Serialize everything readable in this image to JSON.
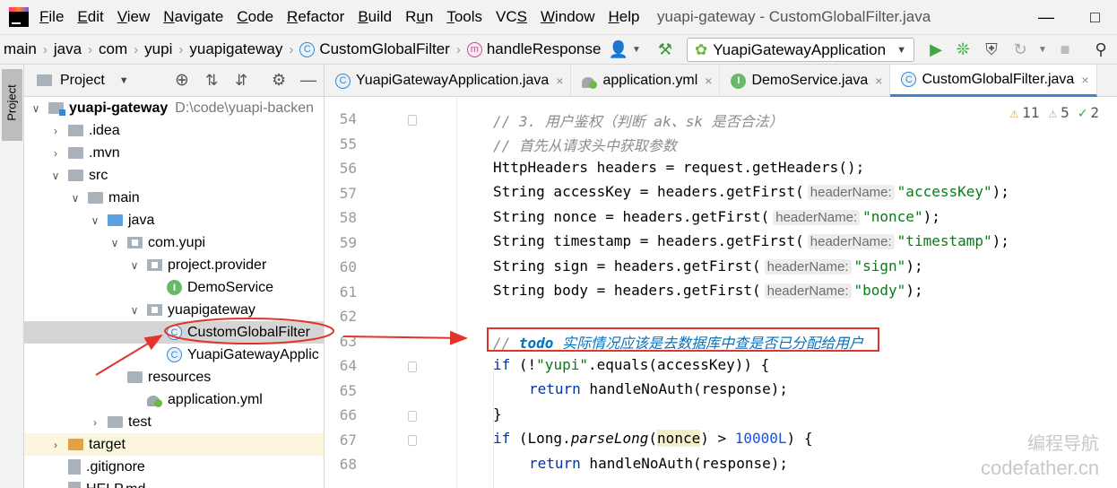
{
  "menubar": {
    "items": [
      {
        "label": "File",
        "u": "F"
      },
      {
        "label": "Edit",
        "u": "E"
      },
      {
        "label": "View",
        "u": "V"
      },
      {
        "label": "Navigate",
        "u": "N"
      },
      {
        "label": "Code",
        "u": "C"
      },
      {
        "label": "Refactor",
        "u": "R"
      },
      {
        "label": "Build",
        "u": "B"
      },
      {
        "label": "Run",
        "u": "u"
      },
      {
        "label": "Tools",
        "u": "T"
      },
      {
        "label": "VCS",
        "u": "S"
      },
      {
        "label": "Window",
        "u": "W"
      },
      {
        "label": "Help",
        "u": "H"
      }
    ],
    "window_title": "yuapi-gateway - CustomGlobalFilter.java"
  },
  "breadcrumb": [
    "main",
    "java",
    "com",
    "yupi",
    "yuapigateway",
    "CustomGlobalFilter",
    "handleResponse"
  ],
  "run_config": {
    "label": "YuapiGatewayApplication"
  },
  "left_stripe": {
    "project_label": "Project"
  },
  "project_panel": {
    "title": "Project",
    "tree": [
      {
        "label": "yuapi-gateway",
        "path": "D:\\code\\yuapi-backen",
        "icon": "module-folder",
        "arrow": "down",
        "bold": true
      },
      {
        "label": ".idea",
        "icon": "folder",
        "arrow": "right"
      },
      {
        "label": ".mvn",
        "icon": "folder",
        "arrow": "right"
      },
      {
        "label": "src",
        "icon": "folder",
        "arrow": "down"
      },
      {
        "label": "main",
        "icon": "folder",
        "arrow": "down"
      },
      {
        "label": "java",
        "icon": "source-folder",
        "arrow": "down"
      },
      {
        "label": "com.yupi",
        "icon": "package",
        "arrow": "down"
      },
      {
        "label": "project.provider",
        "icon": "package",
        "arrow": "down"
      },
      {
        "label": "DemoService",
        "icon": "interface"
      },
      {
        "label": "yuapigateway",
        "icon": "package",
        "arrow": "down"
      },
      {
        "label": "CustomGlobalFilter",
        "icon": "class"
      },
      {
        "label": "YuapiGatewayApplic",
        "icon": "class"
      },
      {
        "label": "resources",
        "icon": "resources-folder"
      },
      {
        "label": "application.yml",
        "icon": "yml"
      },
      {
        "label": "test",
        "icon": "folder",
        "arrow": "right"
      },
      {
        "label": "target",
        "icon": "excluded-folder",
        "arrow": "right"
      },
      {
        "label": ".gitignore",
        "icon": "file"
      },
      {
        "label": "HELP.md",
        "icon": "file"
      }
    ]
  },
  "editor": {
    "tabs": [
      {
        "label": "YuapiGatewayApplication.java",
        "icon": "class"
      },
      {
        "label": "application.yml",
        "icon": "yml"
      },
      {
        "label": "DemoService.java",
        "icon": "interface"
      },
      {
        "label": "CustomGlobalFilter.java",
        "icon": "class",
        "active": true
      }
    ],
    "inspections": {
      "warnings": "11",
      "weak_warnings": "5",
      "typos": "2"
    },
    "line_numbers": [
      "54",
      "55",
      "56",
      "57",
      "58",
      "59",
      "60",
      "61",
      "62",
      "63",
      "64",
      "65",
      "66",
      "67",
      "68"
    ],
    "code": {
      "l54": "// 3. 用户鉴权（判断 ak、sk 是否合法）",
      "l55": "// 首先从请求头中获取参数",
      "l56": "HttpHeaders headers = request.getHeaders();",
      "l57_a": "String accessKey = headers.getFirst(",
      "l57_hint": "headerName:",
      "l57_str": "\"accessKey\"",
      "l58_a": "String nonce = headers.getFirst(",
      "l58_str": "\"nonce\"",
      "l59_a": "String timestamp = headers.getFirst(",
      "l59_str": "\"timestamp\"",
      "l60_a": "String sign = headers.getFirst(",
      "l60_str": "\"sign\"",
      "l61_a": "String body = headers.getFirst(",
      "l61_str": "\"body\"",
      "close": ");",
      "l63_prefix": "// ",
      "l63_todo": "todo",
      "l63_text": " 实际情况应该是去数据库中查是否已分配给用户",
      "kw_if": "if",
      "l64_a": " (!",
      "l64_str": "\"yupi\"",
      "l64_b": ".equals(accessKey)) {",
      "kw_return": "return",
      "l65_b": " handleNoAuth(response);",
      "l66": "}",
      "l67_a": " (Long.",
      "l67_m": "parseLong",
      "l67_p": "(",
      "l67_hl": "nonce",
      "l67_b": ") > ",
      "l67_num": "10000L",
      "l67_c": ") {",
      "l68_b": " handleNoAuth(response);"
    }
  },
  "watermark": {
    "line1": "编程导航",
    "line2": "codefather.cn"
  },
  "colors": {
    "annotation": "#e1342b",
    "accent": "#4083c9"
  }
}
